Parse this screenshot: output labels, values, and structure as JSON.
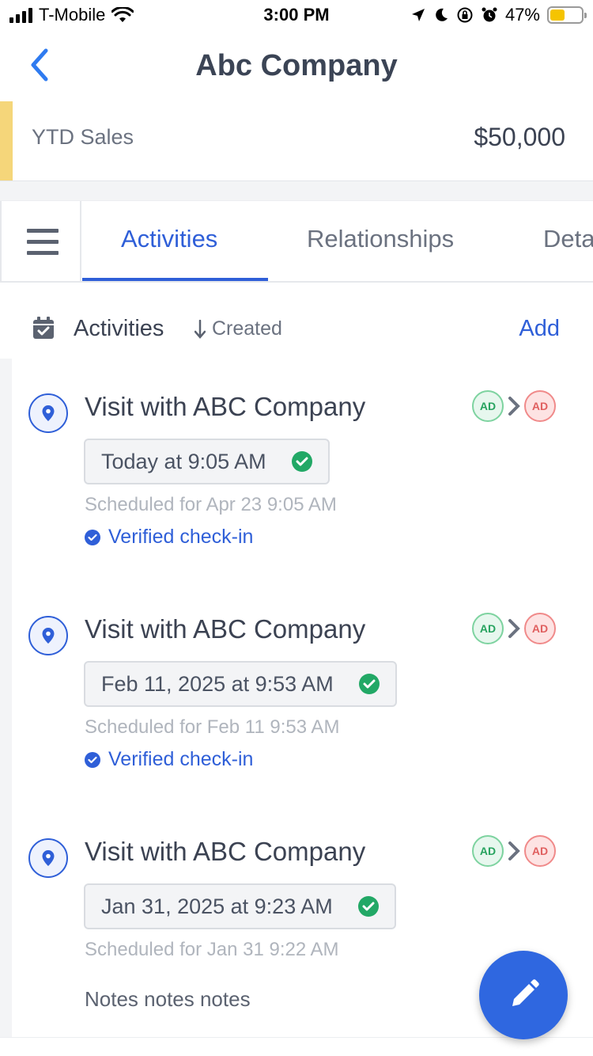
{
  "status_bar": {
    "carrier": "T-Mobile",
    "time": "3:00 PM",
    "battery_percent": "47%",
    "battery_level": 0.47,
    "icons": [
      "signal-icon",
      "wifi-icon",
      "location-arrow-icon",
      "moon-icon",
      "orientation-lock-icon",
      "alarm-icon",
      "battery-icon"
    ]
  },
  "header": {
    "title": "Abc Company",
    "back_icon": "chevron-left-icon"
  },
  "summary": {
    "label": "YTD Sales",
    "value": "$50,000",
    "accent_color": "#f5d67a"
  },
  "tabs": {
    "menu_icon": "hamburger-menu-icon",
    "items": [
      {
        "label": "Activities",
        "active": true
      },
      {
        "label": "Relationships",
        "active": false
      },
      {
        "label": "Details",
        "active": false
      }
    ]
  },
  "section": {
    "title": "Activities",
    "sort_label": "Created",
    "add_label": "Add",
    "icon": "calendar-check-icon"
  },
  "activities": [
    {
      "title": "Visit with ABC Company",
      "date": "Today at 9:05 AM",
      "scheduled": "Scheduled for Apr 23 9:05 AM",
      "verified": "Verified check-in",
      "from_initials": "AD",
      "to_initials": "AD"
    },
    {
      "title": "Visit with ABC Company",
      "date": "Feb 11, 2025 at 9:53 AM",
      "scheduled": "Scheduled for Feb 11 9:53 AM",
      "verified": "Verified check-in",
      "from_initials": "AD",
      "to_initials": "AD"
    },
    {
      "title": "Visit with ABC Company",
      "date": "Jan 31, 2025 at 9:23 AM",
      "scheduled": "Scheduled for Jan 31 9:22 AM",
      "notes": "Notes notes notes",
      "from_initials": "AD",
      "to_initials": "AD"
    }
  ],
  "fab": {
    "icon": "pencil-icon"
  },
  "colors": {
    "primary": "#2f5fd8",
    "success": "#22a866",
    "text": "#3b4252",
    "muted": "#6b7280"
  }
}
